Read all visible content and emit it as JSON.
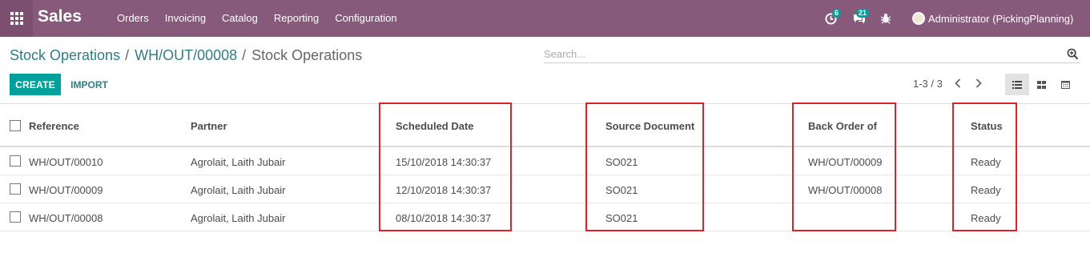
{
  "navbar": {
    "brand": "Sales",
    "menu": [
      "Orders",
      "Invoicing",
      "Catalog",
      "Reporting",
      "Configuration"
    ],
    "activity_count": "6",
    "message_count": "21",
    "user": "Administrator (PickingPlanning)"
  },
  "breadcrumb": {
    "first": "Stock Operations",
    "second": "WH/OUT/00008",
    "current": "Stock Operations",
    "separator": "/"
  },
  "search": {
    "placeholder": "Search..."
  },
  "buttons": {
    "create": "CREATE",
    "import": "IMPORT"
  },
  "pager": {
    "value": "1-3 / 3"
  },
  "table": {
    "headers": {
      "reference": "Reference",
      "partner": "Partner",
      "scheduled_date": "Scheduled Date",
      "source_document": "Source Document",
      "back_order_of": "Back Order of",
      "status": "Status"
    },
    "rows": [
      {
        "reference": "WH/OUT/00010",
        "partner": "Agrolait, Laith Jubair",
        "scheduled_date": "15/10/2018 14:30:37",
        "source_document": "SO021",
        "back_order_of": "WH/OUT/00009",
        "status": "Ready"
      },
      {
        "reference": "WH/OUT/00009",
        "partner": "Agrolait, Laith Jubair",
        "scheduled_date": "12/10/2018 14:30:37",
        "source_document": "SO021",
        "back_order_of": "WH/OUT/00008",
        "status": "Ready"
      },
      {
        "reference": "WH/OUT/00008",
        "partner": "Agrolait, Laith Jubair",
        "scheduled_date": "08/10/2018 14:30:37",
        "source_document": "SO021",
        "back_order_of": "",
        "status": "Ready"
      }
    ]
  },
  "colors": {
    "navbar": "#875a7b",
    "primary": "#00a09d",
    "link": "#2f7e81",
    "highlight": "#e0202a"
  },
  "icons": {
    "apps": "apps-grid-icon",
    "activity": "clock-icon",
    "messages": "chat-icon",
    "debug": "bug-icon",
    "search": "search-plus-icon",
    "list_view": "list-view-icon",
    "kanban_view": "kanban-view-icon",
    "calendar_view": "calendar-view-icon"
  }
}
